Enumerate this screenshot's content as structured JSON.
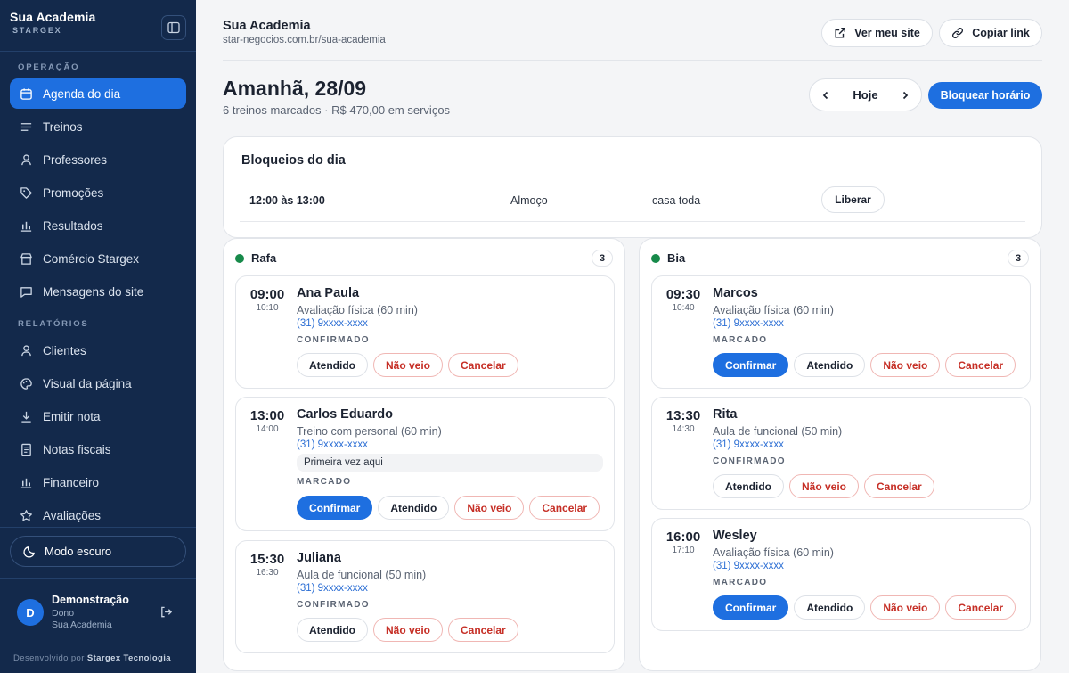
{
  "sidebar": {
    "brand": "Sua Academia",
    "brand_sub": "STARGEX",
    "section_operacao": "OPERAÇÃO",
    "section_relatorios": "RELATÓRIOS",
    "items": [
      {
        "label": "Agenda do dia",
        "icon": "calendar-icon"
      },
      {
        "label": "Treinos",
        "icon": "list-icon"
      },
      {
        "label": "Professores",
        "icon": "person-icon"
      },
      {
        "label": "Promoções",
        "icon": "tag-icon"
      },
      {
        "label": "Resultados",
        "icon": "bar-chart-icon"
      },
      {
        "label": "Comércio Stargex",
        "icon": "store-icon"
      },
      {
        "label": "Mensagens do site",
        "icon": "message-icon"
      },
      {
        "label": "Clientes",
        "icon": "person-icon"
      },
      {
        "label": "Visual da página",
        "icon": "palette-icon"
      },
      {
        "label": "Emitir nota",
        "icon": "download-icon"
      },
      {
        "label": "Notas fiscais",
        "icon": "receipt-icon"
      },
      {
        "label": "Financeiro",
        "icon": "bar-chart-icon"
      },
      {
        "label": "Avaliações",
        "icon": "star-icon"
      }
    ],
    "dark_mode": "Modo escuro",
    "user": {
      "initial": "D",
      "name": "Demonstração",
      "role": "Dono",
      "org": "Sua Academia"
    },
    "credit_prefix": "Desenvolvido por",
    "credit_company": "Stargex Tecnologia"
  },
  "header": {
    "title": "Sua Academia",
    "url": "star-negocios.com.br/sua-academia",
    "view_site": "Ver meu site",
    "copy_link": "Copiar link"
  },
  "day": {
    "title": "Amanhã, 28/09",
    "subtitle": "6 treinos marcados · R$ 470,00 em serviços",
    "today": "Hoje",
    "block_button": "Bloquear horário"
  },
  "blocks": {
    "title": "Bloqueios do dia",
    "row": {
      "time": "12:00 às 13:00",
      "reason": "Almoço",
      "scope": "casa toda",
      "action": "Liberar"
    }
  },
  "columns": [
    {
      "name": "Rafa",
      "count": "3",
      "appointments": [
        {
          "time": "09:00",
          "end": "10:10",
          "name": "Ana Paula",
          "service": "Avaliação física (60 min)",
          "phone": "(31) 9xxxx-xxxx",
          "status": "CONFIRMADO",
          "actions": [
            "Atendido",
            "Não veio",
            "Cancelar"
          ]
        },
        {
          "time": "13:00",
          "end": "14:00",
          "name": "Carlos Eduardo",
          "service": "Treino com personal (60 min)",
          "phone": "(31) 9xxxx-xxxx",
          "note": "Primeira vez aqui",
          "status": "MARCADO",
          "actions": [
            "Confirmar",
            "Atendido",
            "Não veio",
            "Cancelar"
          ]
        },
        {
          "time": "15:30",
          "end": "16:30",
          "name": "Juliana",
          "service": "Aula de funcional (50 min)",
          "phone": "(31) 9xxxx-xxxx",
          "status": "CONFIRMADO",
          "actions": [
            "Atendido",
            "Não veio",
            "Cancelar"
          ]
        }
      ]
    },
    {
      "name": "Bia",
      "count": "3",
      "appointments": [
        {
          "time": "09:30",
          "end": "10:40",
          "name": "Marcos",
          "service": "Avaliação física (60 min)",
          "phone": "(31) 9xxxx-xxxx",
          "status": "MARCADO",
          "actions": [
            "Confirmar",
            "Atendido",
            "Não veio",
            "Cancelar"
          ]
        },
        {
          "time": "13:30",
          "end": "14:30",
          "name": "Rita",
          "service": "Aula de funcional (50 min)",
          "phone": "(31) 9xxxx-xxxx",
          "status": "CONFIRMADO",
          "actions": [
            "Atendido",
            "Não veio",
            "Cancelar"
          ]
        },
        {
          "time": "16:00",
          "end": "17:10",
          "name": "Wesley",
          "service": "Avaliação física (60 min)",
          "phone": "(31) 9xxxx-xxxx",
          "status": "MARCADO",
          "actions": [
            "Confirmar",
            "Atendido",
            "Não veio",
            "Cancelar"
          ]
        }
      ]
    }
  ],
  "colors": {
    "accent": "#1e6fe0",
    "sidebar_bg": "#13294b",
    "danger": "#c62f26",
    "online": "#178a4a"
  }
}
